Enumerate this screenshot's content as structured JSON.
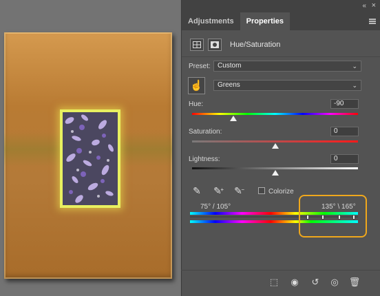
{
  "panel": {
    "tabs": [
      {
        "label": "Adjustments"
      },
      {
        "label": "Properties"
      }
    ],
    "adjustment_title": "Hue/Saturation",
    "preset_label": "Preset:",
    "preset_value": "Custom",
    "channel_value": "Greens",
    "hue": {
      "label": "Hue:",
      "value": "-90",
      "position": -90,
      "min": -180,
      "max": 180
    },
    "saturation": {
      "label": "Saturation:",
      "value": "0",
      "position": 0,
      "min": -100,
      "max": 100
    },
    "lightness": {
      "label": "Lightness:",
      "value": "0",
      "position": 0,
      "min": -100,
      "max": 100
    },
    "colorize_label": "Colorize",
    "colorize_checked": false,
    "range_left": "75° /  105°",
    "range_right": "135° \\ 165°"
  },
  "icons": {
    "collapse": "double-chevron-left-icon",
    "close": "close-icon",
    "menu": "menu-icon",
    "hand_tool": "targeted-adjustment-hand-icon",
    "clip": "clip-to-layer-icon",
    "view_previous": "view-previous-state-icon",
    "reset": "reset-icon",
    "visibility": "eye-icon",
    "delete": "trash-icon"
  },
  "colors": {
    "highlight": "#f0a81c",
    "panel_bg": "#535353",
    "artboard": "#b97b33"
  }
}
